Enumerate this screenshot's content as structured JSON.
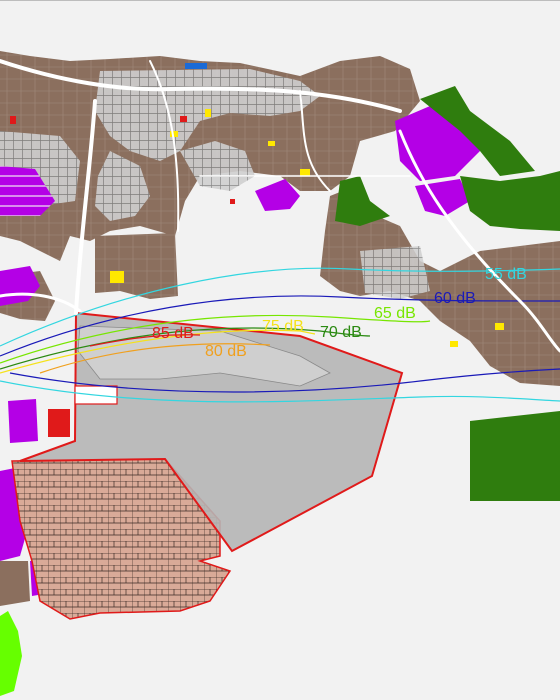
{
  "map": {
    "colors": {
      "background": "#f2f2f2",
      "residential_brown": "#8b6f5e",
      "urban_block_grey": "#9a9a9a",
      "commercial_magenta": "#b400e6",
      "green_area": "#2f7d0e",
      "pink_parcels": "#d9aa98",
      "airport_zone_grey": "#b5b5b5",
      "airport_boundary_red": "#e01a1a",
      "light_green_patch": "#66ff00",
      "yellow_lots": "#ffe800"
    },
    "noise_contours": [
      {
        "id": "55",
        "label": "55 dB",
        "color": "#33d6e0"
      },
      {
        "id": "60",
        "label": "60 dB",
        "color": "#1a1ab8"
      },
      {
        "id": "65",
        "label": "65 dB",
        "color": "#77e600"
      },
      {
        "id": "70",
        "label": "70 dB",
        "color": "#2b8a12"
      },
      {
        "id": "75",
        "label": "75 dB",
        "color": "#f5e21a"
      },
      {
        "id": "80",
        "label": "80 dB",
        "color": "#f0a01e"
      },
      {
        "id": "85",
        "label": "85 dB",
        "color": "#e01a1a"
      }
    ]
  }
}
